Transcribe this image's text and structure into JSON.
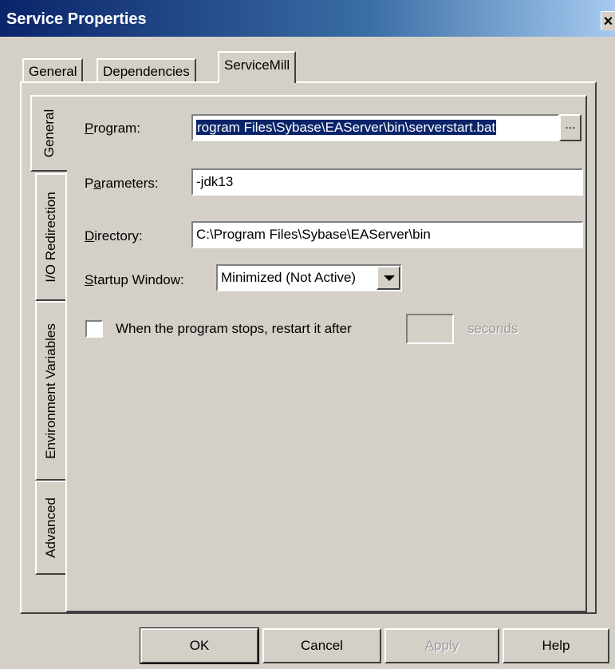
{
  "window": {
    "title": "Service Properties",
    "close_glyph": "×"
  },
  "tabs": [
    {
      "label": "General"
    },
    {
      "label": "Dependencies"
    },
    {
      "label": "ServiceMill",
      "active": true
    }
  ],
  "side_tabs": [
    {
      "label": "General",
      "active": true
    },
    {
      "label": "I/O Redirection"
    },
    {
      "label": "Environment Variables"
    },
    {
      "label": "Advanced"
    }
  ],
  "form": {
    "program": {
      "label_access": "P",
      "label_rest": "rogram:",
      "value": "rogram Files\\Sybase\\EAServer\\bin\\serverstart.bat",
      "browse_label": "..."
    },
    "parameters": {
      "label_pre": "P",
      "label_access": "a",
      "label_rest": "rameters:",
      "value": "-jdk13"
    },
    "directory": {
      "label_access": "D",
      "label_rest": "irectory:",
      "value": "C:\\Program Files\\Sybase\\EAServer\\bin"
    },
    "startup_window": {
      "label_access": "S",
      "label_rest": "tartup Window:",
      "value": "Minimized (Not Active)"
    },
    "restart": {
      "checked": false,
      "label": "When the program stops, restart it after",
      "seconds_value": "",
      "seconds_label": "seconds"
    }
  },
  "buttons": {
    "ok": "OK",
    "cancel": "Cancel",
    "apply_access": "A",
    "apply_rest": "pply",
    "help": "Help"
  }
}
